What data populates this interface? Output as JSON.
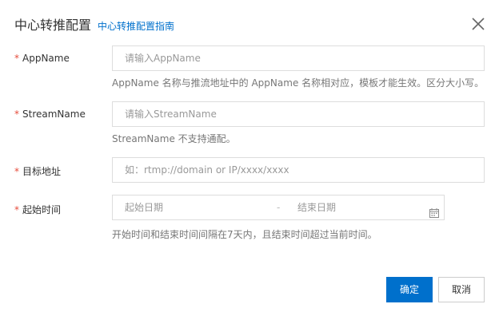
{
  "header": {
    "title": "中心转推配置",
    "guide_link": "中心转推配置指南"
  },
  "form": {
    "appname": {
      "required_mark": "*",
      "label": "AppName",
      "placeholder": "请输入AppName",
      "help": "AppName 名称与推流地址中的 AppName 名称相对应，模板才能生效。区分大小写。"
    },
    "streamname": {
      "required_mark": "*",
      "label": "StreamName",
      "placeholder": "请输入StreamName",
      "help": "StreamName 不支持通配。"
    },
    "target": {
      "required_mark": "*",
      "label": "目标地址",
      "placeholder": "如：rtmp://domain or IP/xxxx/xxxx"
    },
    "time": {
      "required_mark": "*",
      "label": "起始时间",
      "start_placeholder": "起始日期",
      "separator": "-",
      "end_placeholder": "结束日期",
      "help": "开始时间和结束时间间隔在7天内，且结束时间超过当前时间。"
    }
  },
  "footer": {
    "confirm_label": "确定",
    "cancel_label": "取消"
  },
  "colors": {
    "accent": "#0070cc",
    "required": "#e64c3b",
    "border": "#dddddd",
    "help_text": "#777777"
  },
  "icons": {
    "close": "close-icon",
    "calendar": "calendar-icon"
  }
}
